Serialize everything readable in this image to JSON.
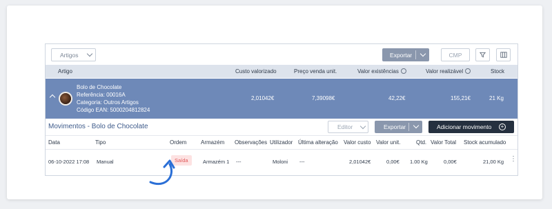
{
  "toolbar": {
    "artigos_label": "Artigos",
    "exportar_label": "Exportar",
    "cmp_label": "CMP"
  },
  "table": {
    "headers": {
      "artigo": "Artigo",
      "custo_valorizado": "Custo valorizado",
      "preco_venda": "Preço venda unit.",
      "valor_existencias": "Valor existências",
      "valor_realizavel": "Valor realizável",
      "stock": "Stock"
    },
    "selected_row": {
      "name": "Bolo de Chocolate",
      "referencia": "Referência: 00016A",
      "categoria": "Categoria: Outros Artigos",
      "ean": "Código EAN: 5000204812824",
      "custo_valorizado": "2,01042€",
      "preco_venda": "7,39098€",
      "valor_existencias": "42,22€",
      "valor_realizavel": "155,21€",
      "stock": "21 Kg"
    }
  },
  "movimentos": {
    "title": "Movimentos - Bolo de Chocolate",
    "editor_label": "Editor",
    "exportar_label": "Exportar",
    "add_label": "Adicionar movimento",
    "headers": {
      "data": "Data",
      "tipo": "Tipo",
      "ordem": "Ordem",
      "armazem": "Armazém",
      "observacoes": "Observações",
      "utilizador": "Utilizador",
      "ultima_alteracao": "Última alteração",
      "valor_custo": "Valor custo",
      "valor_unit": "Valor unit.",
      "qtd": "Qtd.",
      "valor_total": "Valor Total",
      "stock_acumulado": "Stock acumulado"
    },
    "row": {
      "data": "06-10-2022 17:08",
      "tipo": "Manual",
      "ordem": "Saída",
      "armazem": "Armazém 1",
      "observacoes": "---",
      "utilizador": "Moloni",
      "ultima_alteracao": "---",
      "valor_custo": "2,01042€",
      "valor_unit": "0,00€",
      "qtd": "1.00 Kg",
      "valor_total": "0,00€",
      "stock_acumulado": "21,00 Kg"
    }
  },
  "colors": {
    "selected_row_bg": "#6e89b8",
    "export_button_bg": "#8a97ad",
    "dark_button_bg": "#25303f",
    "badge_bg": "#fde2e2",
    "badge_text": "#e0595a",
    "annotation_arrow": "#2b6fd6"
  }
}
